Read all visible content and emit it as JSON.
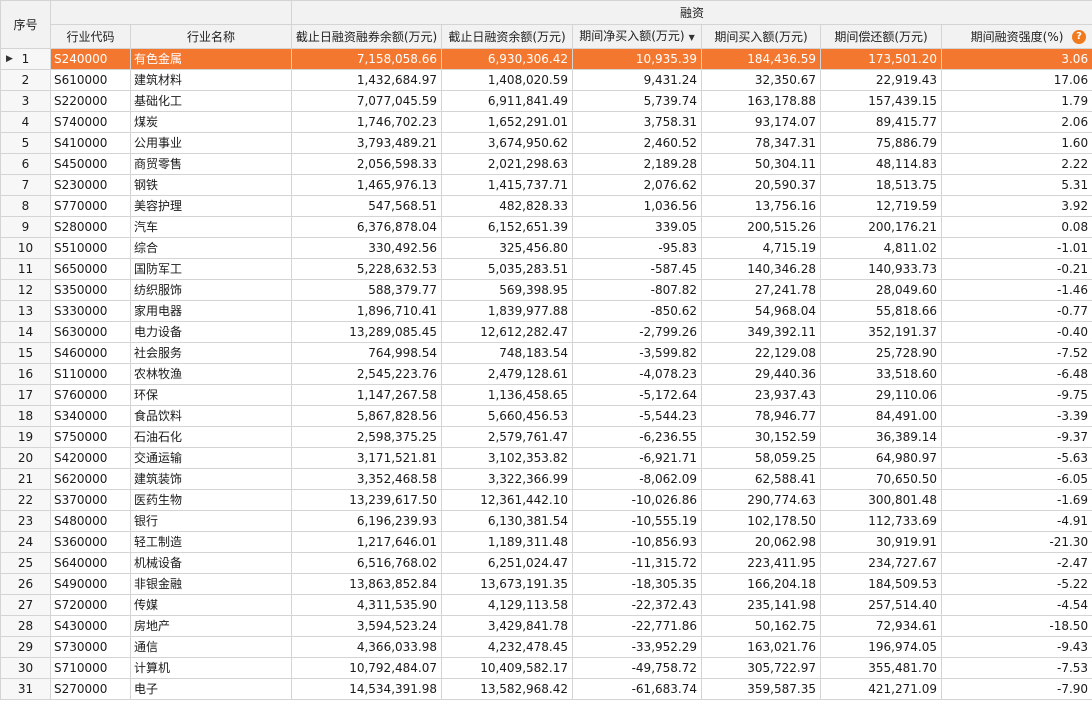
{
  "header": {
    "index": "序号",
    "group": "融资",
    "columns": [
      "行业代码",
      "行业名称",
      "截止日融资融券余额(万元)",
      "截止日融资余额(万元)",
      "期间净买入额(万元)",
      "期间买入额(万元)",
      "期间偿还额(万元)",
      "期间融资强度(%)"
    ],
    "sorted_column": 4,
    "sort_direction": "desc",
    "help_icon": "?"
  },
  "selected_row": 0,
  "rows": [
    {
      "idx": "1",
      "code": "S240000",
      "name": "有色金属",
      "total": "7,158,058.66",
      "fin": "6,930,306.42",
      "net": "10,935.39",
      "buy": "184,436.59",
      "repay": "173,501.20",
      "strength": "3.06"
    },
    {
      "idx": "2",
      "code": "S610000",
      "name": "建筑材料",
      "total": "1,432,684.97",
      "fin": "1,408,020.59",
      "net": "9,431.24",
      "buy": "32,350.67",
      "repay": "22,919.43",
      "strength": "17.06"
    },
    {
      "idx": "3",
      "code": "S220000",
      "name": "基础化工",
      "total": "7,077,045.59",
      "fin": "6,911,841.49",
      "net": "5,739.74",
      "buy": "163,178.88",
      "repay": "157,439.15",
      "strength": "1.79"
    },
    {
      "idx": "4",
      "code": "S740000",
      "name": "煤炭",
      "total": "1,746,702.23",
      "fin": "1,652,291.01",
      "net": "3,758.31",
      "buy": "93,174.07",
      "repay": "89,415.77",
      "strength": "2.06"
    },
    {
      "idx": "5",
      "code": "S410000",
      "name": "公用事业",
      "total": "3,793,489.21",
      "fin": "3,674,950.62",
      "net": "2,460.52",
      "buy": "78,347.31",
      "repay": "75,886.79",
      "strength": "1.60"
    },
    {
      "idx": "6",
      "code": "S450000",
      "name": "商贸零售",
      "total": "2,056,598.33",
      "fin": "2,021,298.63",
      "net": "2,189.28",
      "buy": "50,304.11",
      "repay": "48,114.83",
      "strength": "2.22"
    },
    {
      "idx": "7",
      "code": "S230000",
      "name": "钢铁",
      "total": "1,465,976.13",
      "fin": "1,415,737.71",
      "net": "2,076.62",
      "buy": "20,590.37",
      "repay": "18,513.75",
      "strength": "5.31"
    },
    {
      "idx": "8",
      "code": "S770000",
      "name": "美容护理",
      "total": "547,568.51",
      "fin": "482,828.33",
      "net": "1,036.56",
      "buy": "13,756.16",
      "repay": "12,719.59",
      "strength": "3.92"
    },
    {
      "idx": "9",
      "code": "S280000",
      "name": "汽车",
      "total": "6,376,878.04",
      "fin": "6,152,651.39",
      "net": "339.05",
      "buy": "200,515.26",
      "repay": "200,176.21",
      "strength": "0.08"
    },
    {
      "idx": "10",
      "code": "S510000",
      "name": "综合",
      "total": "330,492.56",
      "fin": "325,456.80",
      "net": "-95.83",
      "buy": "4,715.19",
      "repay": "4,811.02",
      "strength": "-1.01"
    },
    {
      "idx": "11",
      "code": "S650000",
      "name": "国防军工",
      "total": "5,228,632.53",
      "fin": "5,035,283.51",
      "net": "-587.45",
      "buy": "140,346.28",
      "repay": "140,933.73",
      "strength": "-0.21"
    },
    {
      "idx": "12",
      "code": "S350000",
      "name": "纺织服饰",
      "total": "588,379.77",
      "fin": "569,398.95",
      "net": "-807.82",
      "buy": "27,241.78",
      "repay": "28,049.60",
      "strength": "-1.46"
    },
    {
      "idx": "13",
      "code": "S330000",
      "name": "家用电器",
      "total": "1,896,710.41",
      "fin": "1,839,977.88",
      "net": "-850.62",
      "buy": "54,968.04",
      "repay": "55,818.66",
      "strength": "-0.77"
    },
    {
      "idx": "14",
      "code": "S630000",
      "name": "电力设备",
      "total": "13,289,085.45",
      "fin": "12,612,282.47",
      "net": "-2,799.26",
      "buy": "349,392.11",
      "repay": "352,191.37",
      "strength": "-0.40"
    },
    {
      "idx": "15",
      "code": "S460000",
      "name": "社会服务",
      "total": "764,998.54",
      "fin": "748,183.54",
      "net": "-3,599.82",
      "buy": "22,129.08",
      "repay": "25,728.90",
      "strength": "-7.52"
    },
    {
      "idx": "16",
      "code": "S110000",
      "name": "农林牧渔",
      "total": "2,545,223.76",
      "fin": "2,479,128.61",
      "net": "-4,078.23",
      "buy": "29,440.36",
      "repay": "33,518.60",
      "strength": "-6.48"
    },
    {
      "idx": "17",
      "code": "S760000",
      "name": "环保",
      "total": "1,147,267.58",
      "fin": "1,136,458.65",
      "net": "-5,172.64",
      "buy": "23,937.43",
      "repay": "29,110.06",
      "strength": "-9.75"
    },
    {
      "idx": "18",
      "code": "S340000",
      "name": "食品饮料",
      "total": "5,867,828.56",
      "fin": "5,660,456.53",
      "net": "-5,544.23",
      "buy": "78,946.77",
      "repay": "84,491.00",
      "strength": "-3.39"
    },
    {
      "idx": "19",
      "code": "S750000",
      "name": "石油石化",
      "total": "2,598,375.25",
      "fin": "2,579,761.47",
      "net": "-6,236.55",
      "buy": "30,152.59",
      "repay": "36,389.14",
      "strength": "-9.37"
    },
    {
      "idx": "20",
      "code": "S420000",
      "name": "交通运输",
      "total": "3,171,521.81",
      "fin": "3,102,353.82",
      "net": "-6,921.71",
      "buy": "58,059.25",
      "repay": "64,980.97",
      "strength": "-5.63"
    },
    {
      "idx": "21",
      "code": "S620000",
      "name": "建筑装饰",
      "total": "3,352,468.58",
      "fin": "3,322,366.99",
      "net": "-8,062.09",
      "buy": "62,588.41",
      "repay": "70,650.50",
      "strength": "-6.05"
    },
    {
      "idx": "22",
      "code": "S370000",
      "name": "医药生物",
      "total": "13,239,617.50",
      "fin": "12,361,442.10",
      "net": "-10,026.86",
      "buy": "290,774.63",
      "repay": "300,801.48",
      "strength": "-1.69"
    },
    {
      "idx": "23",
      "code": "S480000",
      "name": "银行",
      "total": "6,196,239.93",
      "fin": "6,130,381.54",
      "net": "-10,555.19",
      "buy": "102,178.50",
      "repay": "112,733.69",
      "strength": "-4.91"
    },
    {
      "idx": "24",
      "code": "S360000",
      "name": "轻工制造",
      "total": "1,217,646.01",
      "fin": "1,189,311.48",
      "net": "-10,856.93",
      "buy": "20,062.98",
      "repay": "30,919.91",
      "strength": "-21.30"
    },
    {
      "idx": "25",
      "code": "S640000",
      "name": "机械设备",
      "total": "6,516,768.02",
      "fin": "6,251,024.47",
      "net": "-11,315.72",
      "buy": "223,411.95",
      "repay": "234,727.67",
      "strength": "-2.47"
    },
    {
      "idx": "26",
      "code": "S490000",
      "name": "非银金融",
      "total": "13,863,852.84",
      "fin": "13,673,191.35",
      "net": "-18,305.35",
      "buy": "166,204.18",
      "repay": "184,509.53",
      "strength": "-5.22"
    },
    {
      "idx": "27",
      "code": "S720000",
      "name": "传媒",
      "total": "4,311,535.90",
      "fin": "4,129,113.58",
      "net": "-22,372.43",
      "buy": "235,141.98",
      "repay": "257,514.40",
      "strength": "-4.54"
    },
    {
      "idx": "28",
      "code": "S430000",
      "name": "房地产",
      "total": "3,594,523.24",
      "fin": "3,429,841.78",
      "net": "-22,771.86",
      "buy": "50,162.75",
      "repay": "72,934.61",
      "strength": "-18.50"
    },
    {
      "idx": "29",
      "code": "S730000",
      "name": "通信",
      "total": "4,366,033.98",
      "fin": "4,232,478.45",
      "net": "-33,952.29",
      "buy": "163,021.76",
      "repay": "196,974.05",
      "strength": "-9.43"
    },
    {
      "idx": "30",
      "code": "S710000",
      "name": "计算机",
      "total": "10,792,484.07",
      "fin": "10,409,582.17",
      "net": "-49,758.72",
      "buy": "305,722.97",
      "repay": "355,481.70",
      "strength": "-7.53"
    },
    {
      "idx": "31",
      "code": "S270000",
      "name": "电子",
      "total": "14,534,391.98",
      "fin": "13,582,968.42",
      "net": "-61,683.74",
      "buy": "359,587.35",
      "repay": "421,271.09",
      "strength": "-7.90"
    }
  ]
}
